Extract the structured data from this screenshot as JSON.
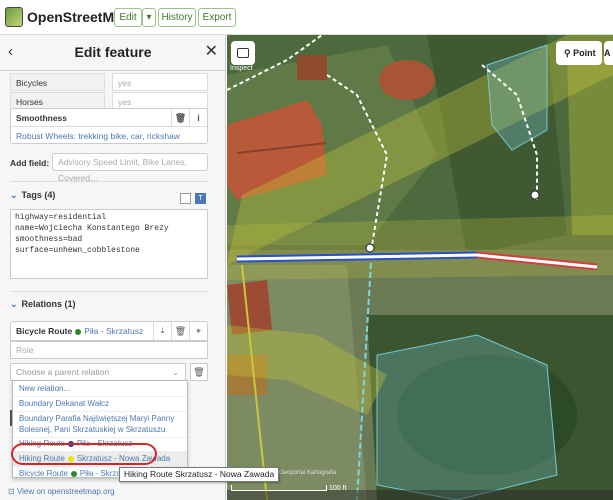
{
  "app": {
    "brand": "OpenStreetMap"
  },
  "toolbar": {
    "edit": "Edit",
    "dropdown": "▾",
    "history": "History",
    "export": "Export"
  },
  "sidebar": {
    "back": "‹",
    "title": "Edit feature",
    "close": "✕",
    "fields": [
      {
        "label": "Bicycles",
        "value": "yes"
      },
      {
        "label": "Horses",
        "value": "yes"
      }
    ],
    "smoothness": {
      "label": "Smoothness",
      "value": "Robust Wheels: trekking bike, car, rickshaw"
    },
    "add_field": {
      "label": "Add field:",
      "placeholder": "Advisory Speed Limit, Bike Lanes, Covered…"
    },
    "tags": {
      "title": "Tags (4)",
      "lines": [
        "highway=residential",
        "name=Wojciecha Konstantego Brezy",
        "smoothness=bad",
        "surface=unhewn_cobblestone"
      ]
    },
    "relations": {
      "title": "Relations (1)",
      "member": {
        "type": "Bicycle Route",
        "name": "Piła - Skrzatusz"
      },
      "role_placeholder": "Role",
      "choose_placeholder": "Choose a parent relation",
      "options": [
        {
          "type": "New relation...",
          "name": ""
        },
        {
          "type": "Boundary",
          "name": "Dekanat Wałcz"
        },
        {
          "type": "Boundary",
          "name": "Parafia Najświętszej Maryi Panny Bolesnej, Pani Skrzatuskiej w Skrzatuszu"
        },
        {
          "type": "Hiking Route",
          "name": "Piła - Skrzatusz"
        },
        {
          "type": "Hiking Route",
          "name": "Skrzatusz - Nowa Zawada"
        },
        {
          "type": "Bicycle Route",
          "name": "Piła - Skrzatusz"
        }
      ]
    },
    "footer": "View on openstreetmap.org"
  },
  "map": {
    "inspect": "Inspect",
    "point": "Point",
    "point_short": "A",
    "attribution": "Geoportal Kartografia",
    "scale": "100 ft"
  },
  "tooltip": "Hiking Route Skrzatusz - Nowa Zawada",
  "colors": {
    "link": "#4a79b3",
    "annotation": "#d02828",
    "hiking_dot": "#e8e800",
    "route_dot_blue": "#2040b0",
    "bicycle_dot": "#2a8a2a"
  }
}
